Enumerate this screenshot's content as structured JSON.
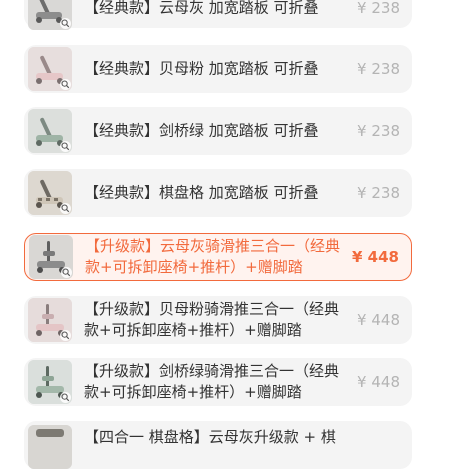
{
  "options": [
    {
      "name": "【经典款】云母灰 加宽踏板 可折叠",
      "price": "¥ 238",
      "selected": false
    },
    {
      "name": "【经典款】贝母粉 加宽踏板 可折叠",
      "price": "¥ 238",
      "selected": false
    },
    {
      "name": "【经典款】剑桥绿 加宽踏板 可折叠",
      "price": "¥ 238",
      "selected": false
    },
    {
      "name": "【经典款】棋盘格 加宽踏板 可折叠",
      "price": "¥ 238",
      "selected": false
    },
    {
      "name": "【升级款】云母灰骑滑推三合一（经典款+可拆卸座椅+推杆）+赠脚踏",
      "price": "¥ 448",
      "selected": true
    },
    {
      "name": "【升级款】贝母粉骑滑推三合一（经典款+可拆卸座椅+推杆）+赠脚踏",
      "price": "¥ 448",
      "selected": false
    },
    {
      "name": "【升级款】剑桥绿骑滑推三合一（经典款+可拆卸座椅+推杆）+赠脚踏",
      "price": "¥ 448",
      "selected": false
    },
    {
      "name": "【四合一 棋盘格】云母灰升级款 + 棋",
      "price": "",
      "selected": false
    }
  ],
  "icons": {
    "zoom": "magnifier-icon"
  },
  "colors": {
    "accent": "#f26a3d",
    "accent_bg": "#fff3ef",
    "item_bg": "#f4f4f4",
    "text": "#333333",
    "price_muted": "#b4b4b4"
  }
}
